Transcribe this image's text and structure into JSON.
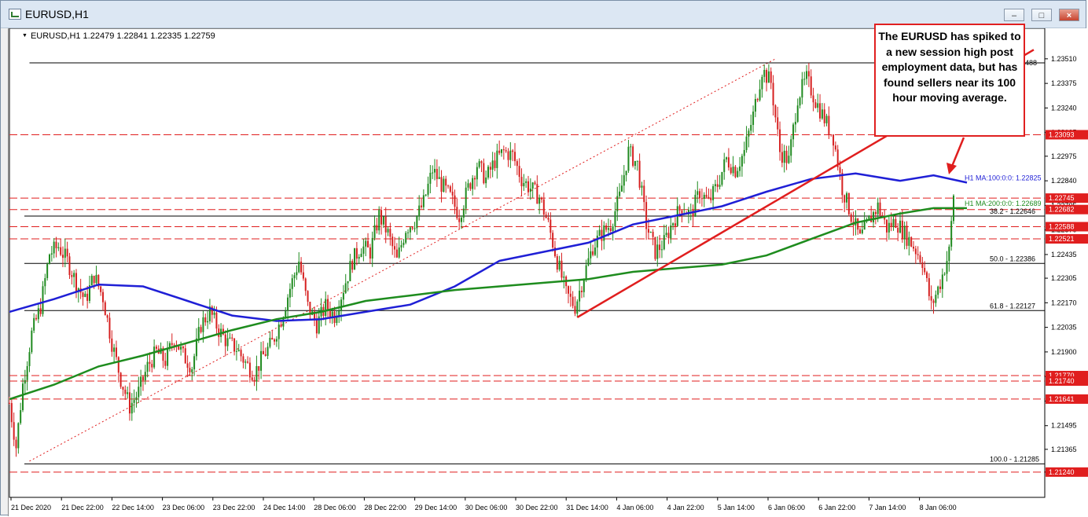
{
  "window": {
    "title": "EURUSD,H1",
    "buttons": {
      "minimize": "–",
      "maximize": "□",
      "close": "×"
    }
  },
  "chart_header": "EURUSD,H1  1.22479 1.22841 1.22335 1.22759",
  "annotation": "The EURUSD has spiked to a new session high post employment data, but has found sellers near its 100 hour moving average.",
  "colors": {
    "bull_candle": "#1f8a1f",
    "bear_candle": "#d62020",
    "ma100": "#1f1fd6",
    "ma200": "#1e8c1e",
    "trendline": "#e01e1e",
    "level_line": "#e01e1e",
    "fib_line": "#000000"
  },
  "chart_data": {
    "type": "candlestick",
    "symbol": "EURUSD",
    "timeframe": "H1",
    "ylim": [
      1.2114,
      1.236
    ],
    "y_ticks": [
      "1.23510",
      "1.23375",
      "1.23240",
      "1.23105",
      "1.22975",
      "1.22840",
      "1.22705",
      "1.22570",
      "1.22435",
      "1.22305",
      "1.22170",
      "1.22035",
      "1.21900",
      "1.21765",
      "1.21630",
      "1.21495",
      "1.21365",
      "1.21240"
    ],
    "x_ticks": [
      "21 Dec 2020",
      "21 Dec 22:00",
      "22 Dec 14:00",
      "23 Dec 06:00",
      "23 Dec 22:00",
      "24 Dec 14:00",
      "28 Dec 06:00",
      "28 Dec 22:00",
      "29 Dec 14:00",
      "30 Dec 06:00",
      "30 Dec 22:00",
      "31 Dec 14:00",
      "4 Jan 06:00",
      "4 Jan 22:00",
      "5 Jan 14:00",
      "6 Jan 06:00",
      "6 Jan 22:00",
      "7 Jan 14:00",
      "8 Jan 06:00"
    ],
    "price_path": [
      [
        0,
        1.2162
      ],
      [
        3,
        1.2138
      ],
      [
        6,
        1.2172
      ],
      [
        10,
        1.22
      ],
      [
        14,
        1.2215
      ],
      [
        18,
        1.2244
      ],
      [
        22,
        1.2248
      ],
      [
        26,
        1.224
      ],
      [
        30,
        1.2228
      ],
      [
        34,
        1.2218
      ],
      [
        38,
        1.2232
      ],
      [
        42,
        1.222
      ],
      [
        46,
        1.2195
      ],
      [
        50,
        1.2175
      ],
      [
        54,
        1.216
      ],
      [
        58,
        1.2168
      ],
      [
        62,
        1.2182
      ],
      [
        66,
        1.219
      ],
      [
        70,
        1.2185
      ],
      [
        74,
        1.2198
      ],
      [
        78,
        1.2188
      ],
      [
        82,
        1.2182
      ],
      [
        86,
        1.2205
      ],
      [
        90,
        1.2212
      ],
      [
        94,
        1.2202
      ],
      [
        98,
        1.2195
      ],
      [
        102,
        1.2192
      ],
      [
        106,
        1.2184
      ],
      [
        110,
        1.2178
      ],
      [
        114,
        1.2188
      ],
      [
        118,
        1.2195
      ],
      [
        122,
        1.2208
      ],
      [
        126,
        1.2225
      ],
      [
        130,
        1.224
      ],
      [
        134,
        1.2215
      ],
      [
        138,
        1.2205
      ],
      [
        142,
        1.2215
      ],
      [
        146,
        1.221
      ],
      [
        150,
        1.2225
      ],
      [
        154,
        1.224
      ],
      [
        158,
        1.2248
      ],
      [
        162,
        1.2245
      ],
      [
        166,
        1.2265
      ],
      [
        170,
        1.2255
      ],
      [
        174,
        1.224
      ],
      [
        178,
        1.2258
      ],
      [
        182,
        1.2262
      ],
      [
        186,
        1.2272
      ],
      [
        190,
        1.229
      ],
      [
        194,
        1.2282
      ],
      [
        198,
        1.2275
      ],
      [
        202,
        1.2265
      ],
      [
        206,
        1.228
      ],
      [
        210,
        1.2293
      ],
      [
        214,
        1.2285
      ],
      [
        218,
        1.2295
      ],
      [
        222,
        1.23
      ],
      [
        226,
        1.2298
      ],
      [
        230,
        1.2285
      ],
      [
        234,
        1.228
      ],
      [
        238,
        1.2275
      ],
      [
        242,
        1.226
      ],
      [
        246,
        1.224
      ],
      [
        250,
        1.2222
      ],
      [
        254,
        1.2215
      ],
      [
        258,
        1.2232
      ],
      [
        262,
        1.2248
      ],
      [
        266,
        1.2255
      ],
      [
        270,
        1.226
      ],
      [
        274,
        1.2275
      ],
      [
        278,
        1.23
      ],
      [
        282,
        1.2293
      ],
      [
        286,
        1.226
      ],
      [
        290,
        1.2245
      ],
      [
        294,
        1.225
      ],
      [
        298,
        1.2262
      ],
      [
        302,
        1.227
      ],
      [
        306,
        1.2265
      ],
      [
        310,
        1.2278
      ],
      [
        314,
        1.2272
      ],
      [
        318,
        1.2282
      ],
      [
        322,
        1.2296
      ],
      [
        326,
        1.229
      ],
      [
        330,
        1.23
      ],
      [
        334,
        1.232
      ],
      [
        338,
        1.2345
      ],
      [
        342,
        1.2338
      ],
      [
        346,
        1.23
      ],
      [
        350,
        1.2295
      ],
      [
        354,
        1.233
      ],
      [
        358,
        1.234
      ],
      [
        362,
        1.2328
      ],
      [
        366,
        1.2318
      ],
      [
        370,
        1.2308
      ],
      [
        374,
        1.228
      ],
      [
        378,
        1.2265
      ],
      [
        382,
        1.2252
      ],
      [
        386,
        1.2262
      ],
      [
        390,
        1.227
      ],
      [
        394,
        1.2258
      ],
      [
        398,
        1.2262
      ],
      [
        402,
        1.2255
      ],
      [
        406,
        1.2248
      ],
      [
        410,
        1.224
      ],
      [
        414,
        1.2215
      ],
      [
        418,
        1.2228
      ],
      [
        422,
        1.2245
      ],
      [
        424,
        1.2276
      ]
    ],
    "series": [
      {
        "name": "H1 MA:100:0:0: 1.22825",
        "points": [
          [
            0,
            1.2212
          ],
          [
            20,
            1.2219
          ],
          [
            40,
            1.2227
          ],
          [
            60,
            1.2226
          ],
          [
            80,
            1.2218
          ],
          [
            100,
            1.221
          ],
          [
            120,
            1.2207
          ],
          [
            140,
            1.2208
          ],
          [
            160,
            1.2212
          ],
          [
            180,
            1.2216
          ],
          [
            200,
            1.2226
          ],
          [
            220,
            1.224
          ],
          [
            240,
            1.2245
          ],
          [
            260,
            1.225
          ],
          [
            280,
            1.226
          ],
          [
            300,
            1.2265
          ],
          [
            320,
            1.227
          ],
          [
            340,
            1.2278
          ],
          [
            360,
            1.2285
          ],
          [
            380,
            1.2288
          ],
          [
            400,
            1.2284
          ],
          [
            415,
            1.2287
          ],
          [
            430,
            1.2283
          ]
        ]
      },
      {
        "name": "H1 MA:200:0:0: 1.22689",
        "points": [
          [
            0,
            1.2164
          ],
          [
            20,
            1.2172
          ],
          [
            40,
            1.2182
          ],
          [
            60,
            1.2188
          ],
          [
            80,
            1.2195
          ],
          [
            100,
            1.2202
          ],
          [
            120,
            1.2208
          ],
          [
            140,
            1.2212
          ],
          [
            160,
            1.2218
          ],
          [
            180,
            1.2221
          ],
          [
            200,
            1.2224
          ],
          [
            220,
            1.2226
          ],
          [
            240,
            1.2228
          ],
          [
            260,
            1.223
          ],
          [
            280,
            1.2234
          ],
          [
            300,
            1.2236
          ],
          [
            320,
            1.2238
          ],
          [
            340,
            1.2243
          ],
          [
            360,
            1.2252
          ],
          [
            380,
            1.2261
          ],
          [
            400,
            1.2266
          ],
          [
            415,
            1.2269
          ],
          [
            430,
            1.2269
          ]
        ]
      }
    ],
    "trendlines": [
      {
        "from": [
          255,
          1.2209
        ],
        "to": [
          460,
          1.2356
        ]
      }
    ],
    "dotted_channel": {
      "from": [
        9,
        1.213
      ],
      "to": [
        344,
        1.2351
      ]
    },
    "horizontal_levels": [
      {
        "label": "1.23488",
        "value": 1.23488,
        "style": "solid-black",
        "from_x": 9
      },
      {
        "label": "1.23093",
        "value": 1.23093,
        "style": "dashed-red"
      },
      {
        "label": "1.22745",
        "value": 1.22745,
        "style": "dashed-red"
      },
      {
        "label": "1.22682",
        "value": 1.22682,
        "style": "dashed-red"
      },
      {
        "label": "1.22588",
        "value": 1.22588,
        "style": "dashed-red"
      },
      {
        "label": "1.22521",
        "value": 1.22521,
        "style": "dashed-red"
      },
      {
        "label": "1.21770",
        "value": 1.2177,
        "style": "dashed-red"
      },
      {
        "label": "1.21740",
        "value": 1.2174,
        "style": "dashed-red"
      },
      {
        "label": "1.21641",
        "value": 1.21641,
        "style": "dashed-red"
      },
      {
        "label": "1.21240",
        "value": 1.2124,
        "style": "dashed-red"
      }
    ],
    "fibonacci": [
      {
        "label": "38.2 - 1.22646",
        "value": 1.22646
      },
      {
        "label": "50.0 - 1.22386",
        "value": 1.22386
      },
      {
        "label": "61.8 - 1.22127",
        "value": 1.22127
      },
      {
        "label": "100.0 - 1.21285",
        "value": 1.21285
      }
    ]
  }
}
